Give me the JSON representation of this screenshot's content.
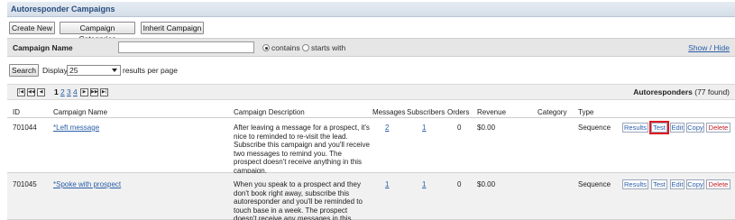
{
  "page": {
    "title": "Autoresponder Campaigns"
  },
  "toolbar": {
    "create_new": "Create New",
    "campaign_categories": "Campaign Categories",
    "inherit_campaign": "Inherit Campaign"
  },
  "filter": {
    "label": "Campaign Name",
    "input_value": "",
    "contains": "contains",
    "starts_with": "starts with",
    "selected_mode": "contains",
    "show_hide": "Show / Hide"
  },
  "display": {
    "search_button": "Search",
    "display_label": "Display",
    "per_page_value": "25",
    "per_page_suffix": "results per page"
  },
  "pager": {
    "first": "|◀",
    "prev_block": "◀◀",
    "prev": "◀",
    "pages": [
      "1",
      "2",
      "3",
      "4"
    ],
    "current_page": "1",
    "next": "▶",
    "next_block": "▶▶",
    "last": "▶|",
    "found_label": "Autoresponders",
    "found_count": "(77 found)"
  },
  "table": {
    "headers": {
      "id": "ID",
      "campaign_name": "Campaign Name",
      "campaign_description": "Campaign Description",
      "messages": "Messages",
      "subscribers": "Subscribers",
      "orders": "Orders",
      "revenue": "Revenue",
      "category": "Category",
      "type": "Type"
    },
    "rows": [
      {
        "id": "701044",
        "name": "*Left message",
        "description": "After leaving a message for a prospect, it's nice to reminded to re-visit the lead. Subscribe this campaign and you'll receive two messages to remind you. The prospect doesn't receive anything in this campaign.",
        "messages": "2",
        "subscribers": "1",
        "orders": "0",
        "revenue": "$0.00",
        "category": "",
        "type": "Sequence"
      },
      {
        "id": "701045",
        "name": "*Spoke with prospect",
        "description": "When you speak to a prospect and they don't book right away, subscribe this autoresponder and you'll be reminded to touch base in a week. The prospect doesn't receive any messages in this",
        "messages": "1",
        "subscribers": "1",
        "orders": "0",
        "revenue": "$0.00",
        "category": "",
        "type": "Sequence"
      }
    ],
    "actions": {
      "results": "Results",
      "test": "Test",
      "edit": "Edit",
      "copy": "Copy",
      "delete": "Delete"
    }
  },
  "colors": {
    "title_text": "#2a4f7f",
    "link": "#2a5ea8",
    "delete": "#c0202a",
    "highlight": "#e0181e"
  }
}
